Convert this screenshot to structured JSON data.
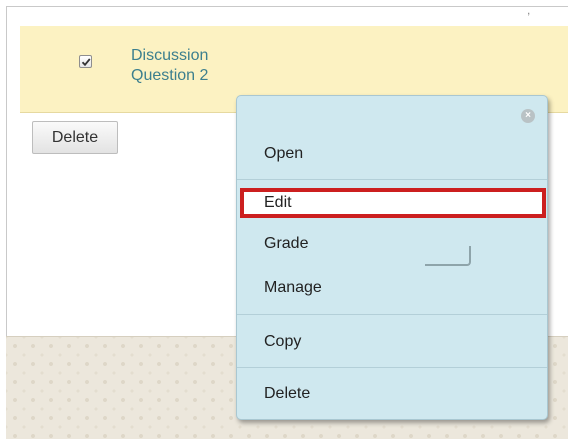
{
  "row": {
    "title": "Discussion Question 2",
    "checked": true
  },
  "delete_button": "Delete",
  "menu": {
    "items": [
      {
        "label": "Open"
      },
      {
        "label": "Edit"
      },
      {
        "label": "Grade"
      },
      {
        "label": "Manage"
      },
      {
        "label": "Copy"
      },
      {
        "label": "Delete"
      }
    ],
    "close_icon": "close-icon",
    "highlight_color": "#cc1f1f",
    "background_color": "#cfe8ef"
  },
  "colors": {
    "row_background": "#fcf2c2",
    "link": "#3c7f8e"
  }
}
